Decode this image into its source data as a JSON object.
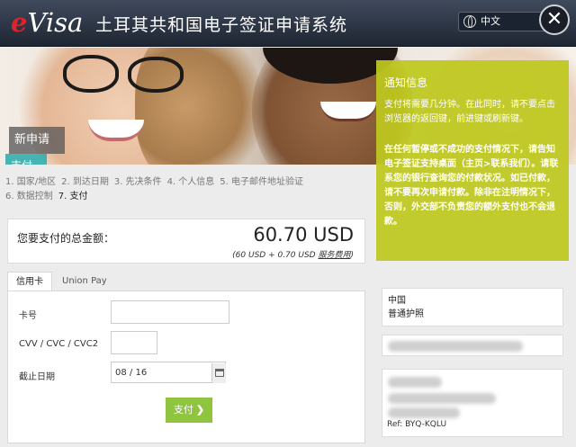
{
  "header": {
    "logo_e": "e",
    "logo_visa": "Visa",
    "title": "土耳其共和国电子签证申请系统",
    "language": "中文",
    "close_label": "✕"
  },
  "hero": {
    "new_application": "新申请",
    "payment": "支付"
  },
  "notice": {
    "title": "通知信息",
    "paragraph1": "支付将需要几分钟。在此同时，请不要点击浏览器的返回键，前进键或刷新键。",
    "paragraph2": "在任何暂停或不成功的支付情况下，请告知电子签证支持桌面（主页>联系我们）。请联系您的银行查询您的付款状况。如已付款，请不要再次申请付款。除非在注明情况下，否则，外交部不负责您的额外支付也不会退款。"
  },
  "steps": [
    {
      "label": "1. 国家/地区"
    },
    {
      "label": "2. 到达日期"
    },
    {
      "label": "3. 先决条件"
    },
    {
      "label": "4. 个人信息"
    },
    {
      "label": "5. 电子邮件地址验证"
    },
    {
      "label": "6. 数据控制"
    },
    {
      "label": "7. 支付"
    }
  ],
  "total": {
    "label": "您要支付的总金额：",
    "amount": "60.70 USD",
    "breakdown_prefix": "(60 USD + 0.70 USD ",
    "breakdown_link": "服务费用",
    "breakdown_suffix": ")"
  },
  "tabs": {
    "credit_card": "信用卡",
    "union_pay": "Union Pay"
  },
  "form": {
    "card_number_label": "卡号",
    "card_number_value": "",
    "cvv_label": "CVV / CVC / CVC2",
    "cvv_value": "",
    "expiry_label": "截止日期",
    "expiry_value": "08 / 16",
    "pay_button": "支付"
  },
  "info": {
    "country": "中国",
    "passport_type": "普通护照",
    "reference": "Ref: BYQ-KQLU"
  },
  "colors": {
    "notice_bg": "#bec81e",
    "pay_button": "#8fc53e",
    "payment_tab": "#28aaaa",
    "logo_e": "#d8262e"
  }
}
